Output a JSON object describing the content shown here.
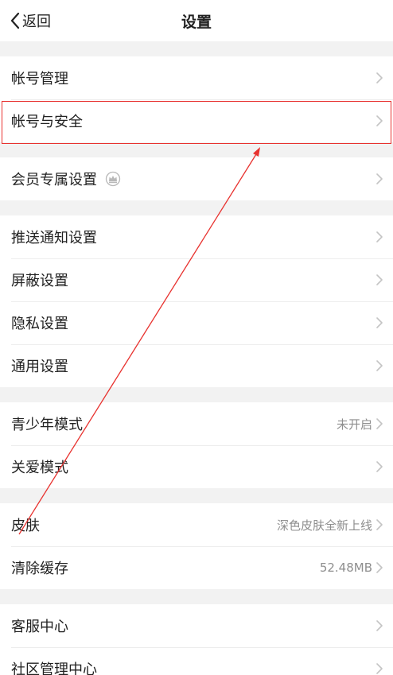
{
  "nav": {
    "back_label": "返回",
    "title": "设置"
  },
  "groups": [
    {
      "items": [
        {
          "label": "帐号管理",
          "value": ""
        },
        {
          "label": "帐号与安全",
          "value": ""
        }
      ]
    },
    {
      "items": [
        {
          "label": "会员专属设置",
          "value": ""
        }
      ]
    },
    {
      "items": [
        {
          "label": "推送通知设置",
          "value": ""
        },
        {
          "label": "屏蔽设置",
          "value": ""
        },
        {
          "label": "隐私设置",
          "value": ""
        },
        {
          "label": "通用设置",
          "value": ""
        }
      ]
    },
    {
      "items": [
        {
          "label": "青少年模式",
          "value": "未开启"
        },
        {
          "label": "关爱模式",
          "value": ""
        }
      ]
    },
    {
      "items": [
        {
          "label": "皮肤",
          "value": "深色皮肤全新上线"
        },
        {
          "label": "清除缓存",
          "value": "52.48MB"
        }
      ]
    },
    {
      "items": [
        {
          "label": "客服中心",
          "value": ""
        },
        {
          "label": "社区管理中心",
          "value": ""
        }
      ]
    }
  ],
  "icons": {
    "back": "chevron-left-icon",
    "chevron": "chevron-right-icon",
    "vip": "crown-icon"
  },
  "colors": {
    "annotation": "#e8322f",
    "chevron": "#c4c4c4",
    "value_text": "#8e8e8e"
  }
}
